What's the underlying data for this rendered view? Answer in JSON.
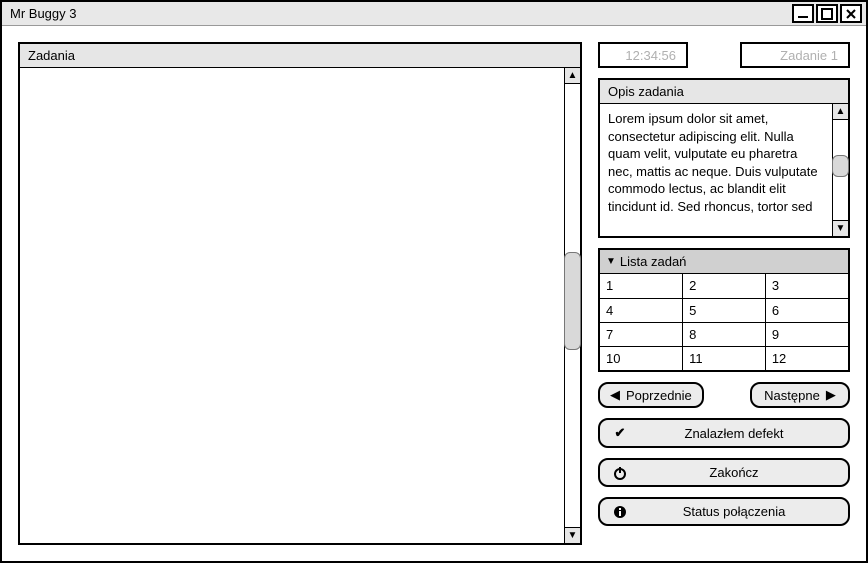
{
  "window": {
    "title": "Mr Buggy 3"
  },
  "left": {
    "header": "Zadania"
  },
  "top": {
    "time": "12:34:56",
    "task": "Zadanie 1"
  },
  "desc": {
    "header": "Opis zadania",
    "text": "Lorem ipsum dolor sit amet, consectetur adipiscing elit. Nulla quam velit, vulputate eu pharetra nec, mattis ac neque. Duis vulputate commodo lectus, ac blandit elit tincidunt id. Sed rhoncus, tortor sed"
  },
  "tasklist": {
    "header": "Lista zadań",
    "rows": [
      [
        "1",
        "2",
        "3"
      ],
      [
        "4",
        "5",
        "6"
      ],
      [
        "7",
        "8",
        "9"
      ],
      [
        "10",
        "11",
        "12"
      ]
    ]
  },
  "nav": {
    "prev": "Poprzednie",
    "next": "Następne"
  },
  "actions": {
    "found_defect": "Znalazłem defekt",
    "finish": "Zakończ",
    "status": "Status połączenia"
  }
}
